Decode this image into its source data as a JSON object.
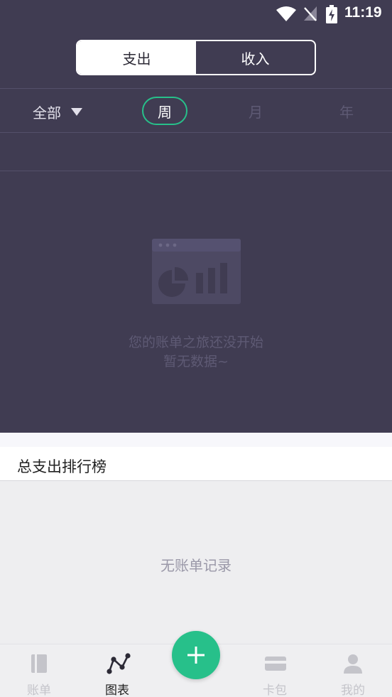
{
  "status_bar": {
    "time": "11:19",
    "icons": [
      "wifi-icon",
      "no-signal-icon",
      "battery-charging-icon"
    ]
  },
  "toggle": {
    "expense": "支出",
    "income": "收入",
    "selected": "expense"
  },
  "filter": {
    "category": "全部",
    "periods": {
      "week": "周",
      "month": "月",
      "year": "年"
    },
    "selected_period": "week"
  },
  "empty_state": {
    "line1": "您的账单之旅还没开始",
    "line2": "暂无数据~",
    "icon": "chart-placeholder-icon"
  },
  "ranking": {
    "title": "总支出排行榜",
    "empty_text": "无账单记录"
  },
  "bottom_nav": {
    "items": [
      {
        "label": "账单",
        "icon": "bill-book-icon"
      },
      {
        "label": "图表",
        "icon": "chart-line-icon",
        "active": true
      },
      {
        "label": "卡包",
        "icon": "card-icon"
      },
      {
        "label": "我的",
        "icon": "user-icon"
      }
    ],
    "add_icon": "plus-icon"
  },
  "colors": {
    "header_bg": "#403c52",
    "accent": "#27c08a",
    "muted_text": "#5e5a74"
  }
}
